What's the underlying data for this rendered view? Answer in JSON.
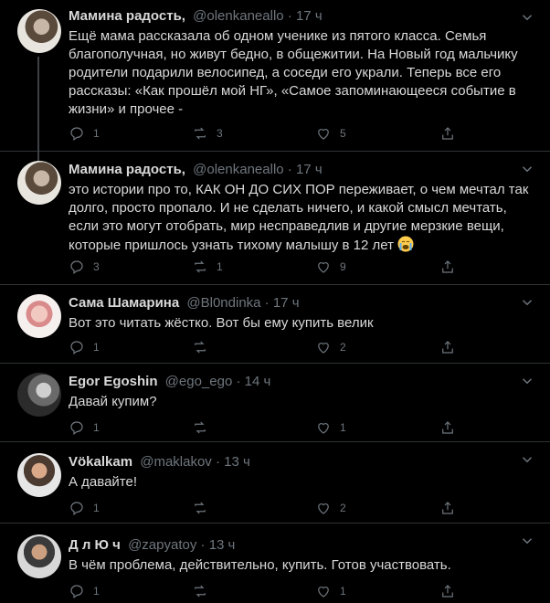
{
  "tweets": [
    {
      "name": "Мамина радость,",
      "handle": "@olenkaneallo",
      "dot": "·",
      "time": "17 ч",
      "text": "Ещё мама рассказала об одном ученике из пятого класса. Семья благополучная, но живут бедно, в общежитии. На Новый год мальчику родители подарили велосипед, а соседи его украли. Теперь все его рассказы: «Как прошёл мой НГ», «Самое запоминающееся событие в жизни» и прочее -",
      "replies": "1",
      "retweets": "3",
      "likes": "5"
    },
    {
      "name": "Мамина радость,",
      "handle": "@olenkaneallo",
      "dot": "·",
      "time": "17 ч",
      "text": "это истории про то, КАК ОН ДО СИХ ПОР переживает, о чем мечтал так долго, просто пропало. И не сделать ничего, и какой смысл мечтать, если это могут отобрать, мир несправедлив и другие мерзкие вещи, которые пришлось узнать тихому малышу в 12 лет",
      "emoji": "crying-face-emoji",
      "replies": "3",
      "retweets": "1",
      "likes": "9"
    },
    {
      "name": "Сама Шамарина",
      "handle": "@Bl0ndinka",
      "dot": "·",
      "time": "17 ч",
      "text": "Вот это читать жёстко. Вот бы ему купить велик",
      "replies": "1",
      "retweets": "",
      "likes": "2"
    },
    {
      "name": "Egor Egoshin",
      "handle": "@ego_ego",
      "dot": "·",
      "time": "14 ч",
      "text": "Давай купим?",
      "replies": "1",
      "retweets": "",
      "likes": "1"
    },
    {
      "name": "Vökalkam",
      "handle": "@maklakov",
      "dot": "·",
      "time": "13 ч",
      "text": "А давайте!",
      "replies": "1",
      "retweets": "",
      "likes": "2"
    },
    {
      "name": "Д л Ю ч",
      "handle": "@zapyatoy",
      "dot": "·",
      "time": "13 ч",
      "text": "В чём проблема, действительно, купить. Готов участвовать.",
      "replies": "1",
      "retweets": "",
      "likes": "1"
    }
  ],
  "colors": {
    "background": "#000000",
    "text": "#d9d9d9",
    "muted": "#6e767d",
    "divider": "#2f3336"
  }
}
